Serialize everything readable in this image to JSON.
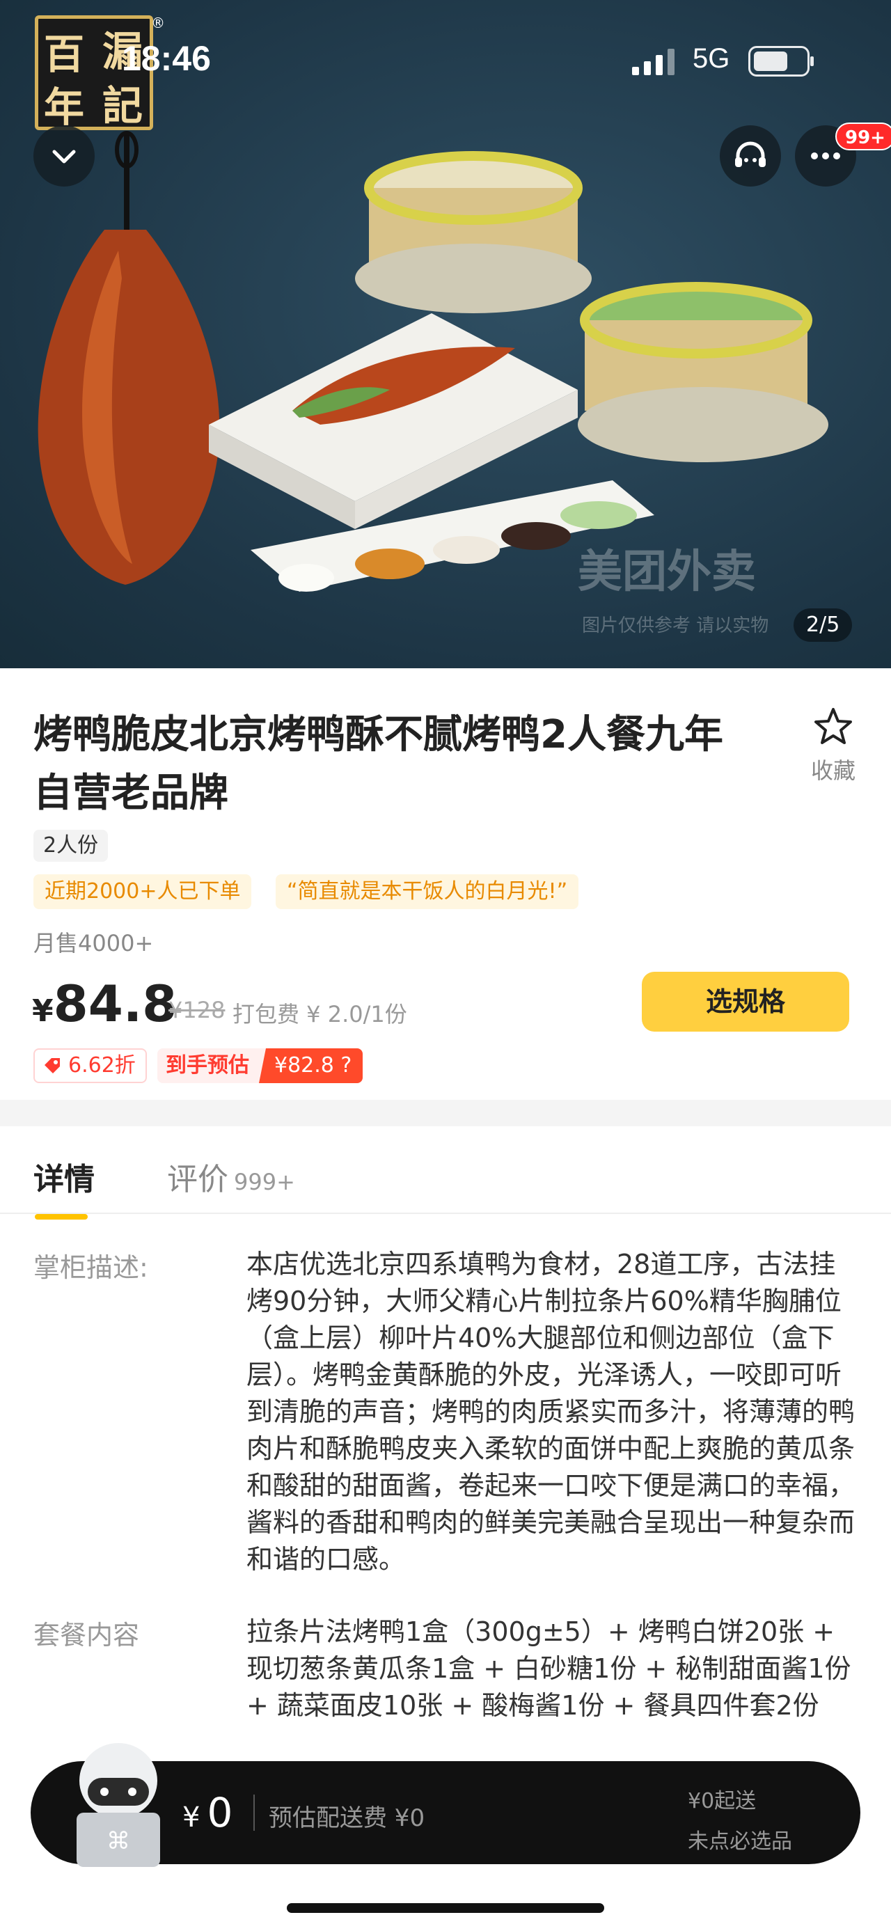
{
  "status_bar": {
    "time": "18:46",
    "network": "5G"
  },
  "hero": {
    "brand_logo_text": "百年漏記",
    "brand_chars": [
      "百",
      "年",
      "漏",
      "記"
    ],
    "notification_badge": "99+",
    "watermark": "美团外卖",
    "watermark_note": "图片仅供参考 请以实物",
    "image_counter": "2/5"
  },
  "product": {
    "title": "烤鸭脆皮北京烤鸭酥不腻烤鸭2人餐九年自营老品牌",
    "favorite_label": "收藏",
    "serving_tag": "2人份",
    "promo_tags": [
      "近期2000+人已下单",
      "“简直就是本干饭人的白月光!”"
    ],
    "monthly_sales": "月售4000+",
    "price_symbol": "¥",
    "price": "84.8",
    "original_price": "¥128",
    "packing_fee": "打包费 ¥ 2.0/1份",
    "select_spec_button": "选规格",
    "discount_tag": "6.62折",
    "estimate_label": "到手预估",
    "estimate_price": "¥82.8 ?"
  },
  "tabs": {
    "detail": "详情",
    "review": "评价",
    "review_count": "999+"
  },
  "detail": {
    "owner_desc_label": "掌柜描述:",
    "owner_desc": "本店优选北京四系填鸭为食材，28道工序，古法挂烤90分钟，大师父精心片制拉条片60%精华胸脯位（盒上层）柳叶片40%大腿部位和侧边部位（盒下层）。烤鸭金黄酥脆的外皮，光泽诱人，一咬即可听到清脆的声音；烤鸭的肉质紧实而多汁，将薄薄的鸭肉片和酥脆鸭皮夹入柔软的面饼中配上爽脆的黄瓜条和酸甜的甜面酱，卷起来一口咬下便是满口的幸福，酱料的香甜和鸭肉的鲜美完美融合呈现出一种复杂而和谐的口感。",
    "package_label": "套餐内容",
    "package_content": "拉条片法烤鸭1盒（300g±5）+ 烤鸭白饼20张 + 现切葱条黄瓜条1盒 + 白砂糖1份 + 秘制甜面酱1份 + 蔬菜面皮10张 + 酸梅酱1份 + 餐具四件套2份"
  },
  "cart": {
    "price_symbol": "¥",
    "total": "0",
    "delivery_fee": "预估配送费 ¥0",
    "min_order": "¥0起送",
    "required_item": "未点必选品"
  }
}
